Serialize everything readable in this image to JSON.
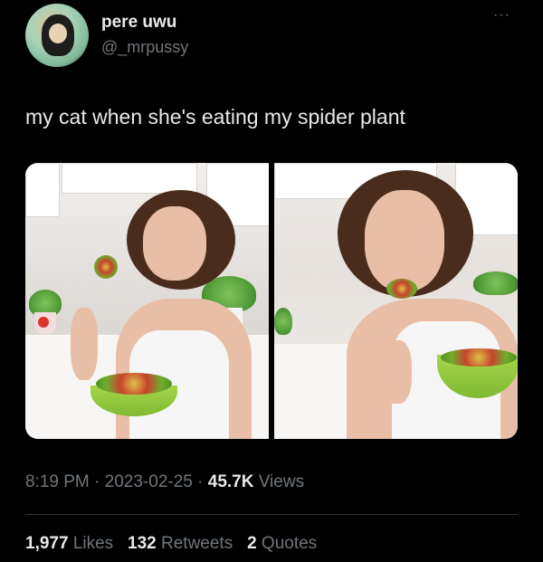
{
  "author": {
    "display_name": "pere uwu",
    "handle": "@_mrpussy"
  },
  "menu": {
    "more_label": "···"
  },
  "tweet": {
    "text": "my cat when she's eating my spider plant"
  },
  "meta": {
    "time": "8:19 PM",
    "separator": " · ",
    "date": "2023-02-25",
    "views_count": "45.7K",
    "views_label": " Views"
  },
  "stats": {
    "likes_count": "1,977",
    "likes_label": " Likes",
    "retweets_count": "132",
    "retweets_label": " Retweets",
    "quotes_count": "2",
    "quotes_label": " Quotes"
  },
  "colors": {
    "background": "#000000",
    "primary_text": "#e7e9ea",
    "secondary_text": "#71767b",
    "divider": "#2f3336"
  }
}
